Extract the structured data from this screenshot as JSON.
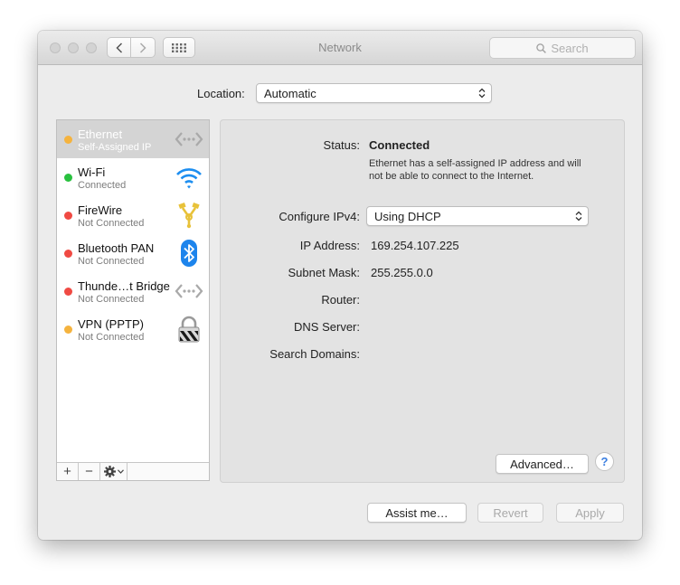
{
  "window": {
    "title": "Network",
    "search_placeholder": "Search"
  },
  "location": {
    "label": "Location:",
    "value": "Automatic"
  },
  "services": [
    {
      "name": "Ethernet",
      "status": "Self-Assigned IP",
      "dot_color": "#f5b33e",
      "icon": "ethernet-arrows-icon",
      "selected": true
    },
    {
      "name": "Wi-Fi",
      "status": "Connected",
      "dot_color": "#29c13f",
      "icon": "wifi-icon",
      "selected": false
    },
    {
      "name": "FireWire",
      "status": "Not Connected",
      "dot_color": "#f04a43",
      "icon": "firewire-icon",
      "selected": false
    },
    {
      "name": "Bluetooth PAN",
      "status": "Not Connected",
      "dot_color": "#f04a43",
      "icon": "bluetooth-icon",
      "selected": false
    },
    {
      "name": "Thunde…t Bridge",
      "status": "Not Connected",
      "dot_color": "#f04a43",
      "icon": "thunderbolt-arrows-icon",
      "selected": false
    },
    {
      "name": "VPN (PPTP)",
      "status": "Not Connected",
      "dot_color": "#f5b33e",
      "icon": "vpn-lock-icon",
      "selected": false
    }
  ],
  "sidebar_toolbar": {
    "add": "+",
    "remove": "−"
  },
  "details": {
    "status_label": "Status:",
    "status_value": "Connected",
    "status_note": "Ethernet has a self-assigned IP address and will not be able to connect to the Internet.",
    "configure_label": "Configure IPv4:",
    "configure_value": "Using DHCP",
    "ip_label": "IP Address:",
    "ip_value": "169.254.107.225",
    "subnet_label": "Subnet Mask:",
    "subnet_value": "255.255.0.0",
    "router_label": "Router:",
    "dns_label": "DNS Server:",
    "search_domains_label": "Search Domains:",
    "advanced_button": "Advanced…",
    "help": "?"
  },
  "footer": {
    "assist": "Assist me…",
    "revert": "Revert",
    "apply": "Apply"
  }
}
